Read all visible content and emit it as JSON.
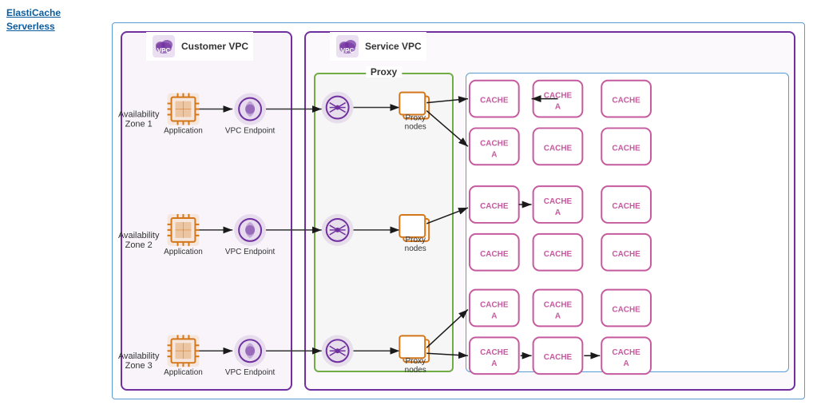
{
  "title": {
    "line1": "ElastiCache",
    "line2": "Serverless"
  },
  "customer_vpc": {
    "label": "Customer VPC"
  },
  "service_vpc": {
    "label": "Service VPC"
  },
  "proxy_box": {
    "label": "Proxy"
  },
  "az_labels": [
    {
      "line1": "Availability",
      "line2": "Zone 1"
    },
    {
      "line1": "Availability",
      "line2": "Zone 2"
    },
    {
      "line1": "Availability",
      "line2": "Zone 3"
    }
  ],
  "node_labels": {
    "application": "Application",
    "vpc_endpoint": "VPC Endpoint",
    "proxy_nodes": "Proxy\nnodes"
  },
  "cache_nodes": {
    "cache_text": "CACHE",
    "cache_a_text": "CACHE\nA"
  },
  "accent_purple": "#7030a0",
  "accent_orange": "#d4771a",
  "accent_pink": "#c55a9e",
  "accent_green": "#70ad47",
  "accent_blue": "#5b9bd5"
}
